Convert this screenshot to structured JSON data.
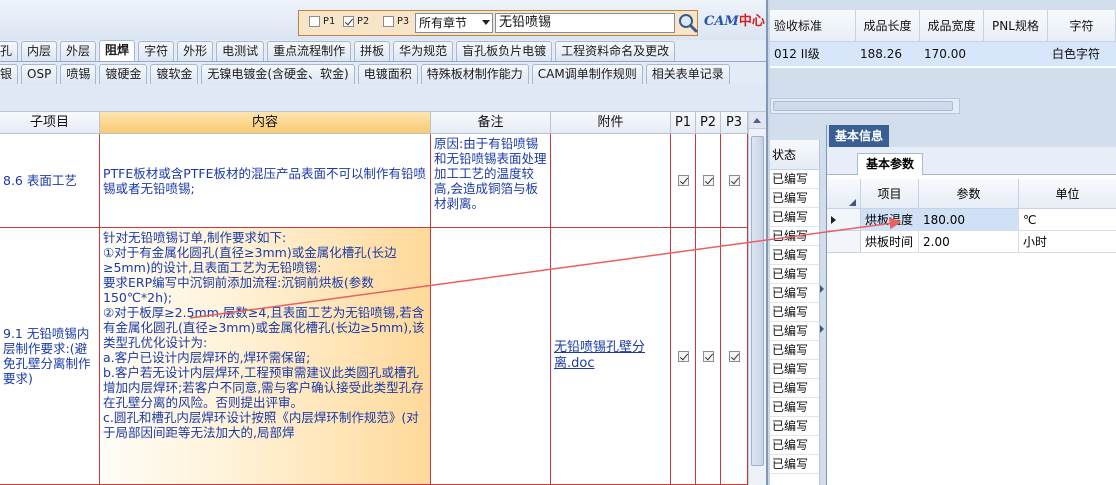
{
  "toolbar": {
    "p1_label": "P1",
    "p2_label": "P2",
    "p3_label": "P3",
    "p1_checked": false,
    "p2_checked": true,
    "p3_checked": false,
    "chapter_select": "所有章节",
    "search_value": "无铅喷锡",
    "logo_text": "CAM",
    "logo_text_red": "中心"
  },
  "tabs_row1": [
    "孔",
    "内层",
    "外层",
    "阻焊",
    "字符",
    "外形",
    "电测试",
    "重点流程制作",
    "拼板",
    "华为规范",
    "盲孔板负片电镀",
    "工程资料命名及更改"
  ],
  "tabs_row1_active": "阻焊",
  "tabs_row2": [
    "银",
    "OSP",
    "喷锡",
    "镀硬金",
    "镀软金",
    "无镍电镀金(含硬金、软金)",
    "电镀面积",
    "特殊板材制作能力",
    "CAM调单制作规则",
    "相关表单记录"
  ],
  "grid": {
    "headers": [
      "子项目",
      "内容",
      "备注",
      "附件",
      "P1",
      "P2",
      "P3"
    ],
    "rows": [
      {
        "sub": "8.6 表面工艺",
        "content": "PTFE板材或含PTFE板材的混压产品表面不可以制作有铅喷锡或者无铅喷锡;",
        "remark": "原因:由于有铅喷锡和无铅喷锡表面处理加工工艺的温度较高,会造成铜箔与板材剥离。",
        "attachment": "",
        "p1": true,
        "p2": true,
        "p3": true
      },
      {
        "sub": "9.1 无铅喷锡内层制作要求:(避免孔壁分离制作要求)",
        "content": "针对无铅喷锡订单,制作要求如下:\n①对于有金属化圆孔(直径≥3mm)或金属化槽孔(长边≥5mm)的设计,且表面工艺为无铅喷锡:\n要求ERP编写中沉铜前添加流程:沉铜前烘板(参数150℃*2h);\n②对于板厚≥2.5mm,层数≥4,且表面工艺为无铅喷锡,若含有金属化圆孔(直径≥3mm)或金属化槽孔(长边≥5mm),该类型孔优化设计为:\na.客户已设计内层焊环的,焊环需保留;\nb.客户若无设计内层焊环,工程预审需建议此类圆孔或槽孔增加内层焊环;若客户不同意,需与客户确认接受此类型孔存在孔壁分离的风险。否则提出评审。\nc.圆孔和槽孔内层焊环设计按照《内层焊环制作规范》(对于局部因间距等无法加大的,局部焊",
        "remark": "",
        "attachment": "无铅喷锡孔壁分离.doc",
        "p1": true,
        "p2": true,
        "p3": true
      }
    ]
  },
  "top_right": {
    "headers": [
      "验收标准",
      "成品长度",
      "成品宽度",
      "PNL规格",
      "字符"
    ],
    "row": {
      "standard": "012 II级",
      "length": "188.26",
      "width": "170.00",
      "pnl": "",
      "char": "白色字符"
    }
  },
  "status_col": {
    "header": "状态",
    "rows": [
      "已编写",
      "已编写",
      "已编写",
      "已编写",
      "已编写",
      "已编写",
      "已编写",
      "已编写",
      "已编写",
      "已编写",
      "已编写",
      "已编写",
      "已编写",
      "已编写",
      "已编写",
      "已编写"
    ]
  },
  "info_panel": {
    "tab": "基本信息",
    "sub_tab": "基本参数",
    "headers": [
      "项目",
      "参数",
      "单位"
    ],
    "rows": [
      {
        "item": "烘板温度",
        "value": "180.00",
        "unit": "℃"
      },
      {
        "item": "烘板时间",
        "value": "2.00",
        "unit": "小时"
      }
    ]
  },
  "colors": {
    "accent": "#3a5f95",
    "grid_border": "#c63c3c",
    "content_text": "#1a3aa8",
    "highlight_header": "#f9c972",
    "annotation_arrow": "#e86060"
  }
}
